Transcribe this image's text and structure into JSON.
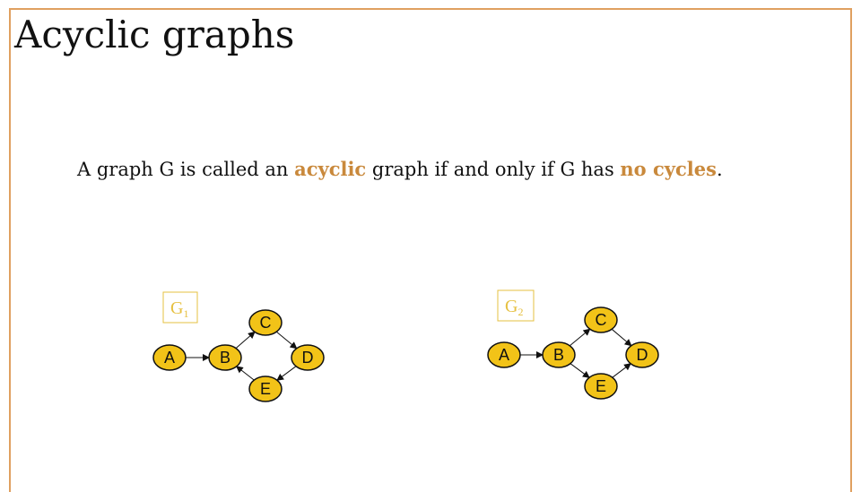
{
  "slide": {
    "title": "Acyclic graphs",
    "statement": {
      "part1": "A graph G is called an ",
      "emph1": "acyclic",
      "part2": " graph if and only if G has ",
      "emph2": "no cycles",
      "part3": "."
    }
  },
  "colors": {
    "frame": "#e0a060",
    "accent": "#c9893c",
    "node_fill": "#f2c318",
    "graph_label": "#e6c040"
  },
  "graphs": [
    {
      "label": "G",
      "subscript": "1",
      "nodes": [
        "A",
        "B",
        "C",
        "D",
        "E"
      ],
      "edges": [
        [
          "A",
          "B"
        ],
        [
          "B",
          "C"
        ],
        [
          "C",
          "D"
        ],
        [
          "D",
          "E"
        ],
        [
          "E",
          "B"
        ]
      ]
    },
    {
      "label": "G",
      "subscript": "2",
      "nodes": [
        "A",
        "B",
        "C",
        "D",
        "E"
      ],
      "edges": [
        [
          "A",
          "B"
        ],
        [
          "B",
          "C"
        ],
        [
          "C",
          "D"
        ],
        [
          "B",
          "E"
        ],
        [
          "E",
          "D"
        ]
      ]
    }
  ]
}
